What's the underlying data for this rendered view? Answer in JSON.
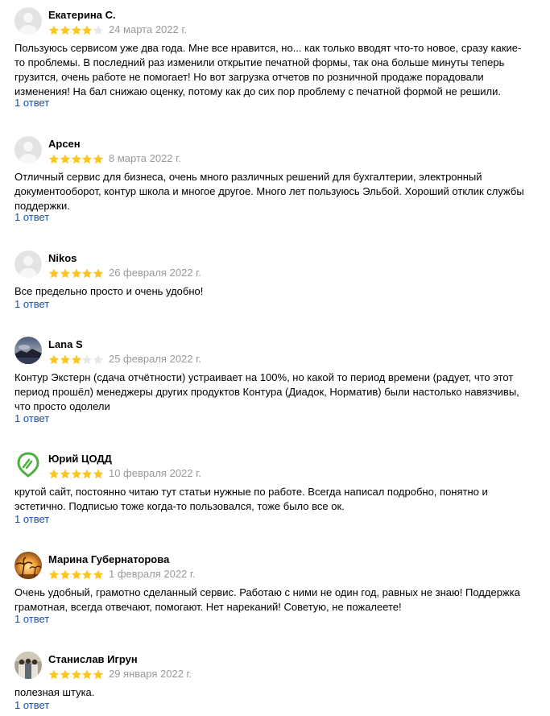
{
  "colors": {
    "star_filled": "#fcc521",
    "star_empty": "#e6e6e6",
    "date": "#999999",
    "link": "#1a4fa8"
  },
  "reviews": [
    {
      "author": "Екатерина С.",
      "avatar": "default-user-avatar",
      "rating": 4,
      "date": "24 марта 2022 г.",
      "text": "Пользуюсь сервисом уже два года. Мне все нравится, но... как только вводят что-то новое, сразу какие-то проблемы. В последний раз изменили открытие печатной формы, так она больше минуты теперь грузится, очень работе не помогает! Но вот загрузка отчетов по розничной продаже порадовали изменения! На бал снижаю оценку, потому как до сих пор проблему с печатной формой не решили.",
      "replies": "1 ответ"
    },
    {
      "author": "Арсен",
      "avatar": "default-user-avatar",
      "rating": 5,
      "date": "8 марта 2022 г.",
      "text": "Отличный сервис для бизнеса, очень много различных решений для бухгалтерии, электронный документооборот, контур школа и многое другое. Много лет пользуюсь Эльбой. Хороший отклик службы поддержки.",
      "replies": "1 ответ"
    },
    {
      "author": "Nikos",
      "avatar": "default-user-avatar",
      "rating": 5,
      "date": "26 февраля 2022 г.",
      "text": "Все предельно просто и очень удобно!",
      "replies": "1 ответ"
    },
    {
      "author": "Lana S",
      "avatar": "landscape-photo-avatar",
      "rating": 3,
      "date": "25 февраля 2022 г.",
      "text": "Контур Экстерн (сдача отчётности) устраивает на 100%, но какой то период времени (радует, что этот период прошёл) менеджеры других продуктов Контура (Диадок, Норматив) были настолько навязчивы, что просто одолели",
      "replies": "1 ответ"
    },
    {
      "author": "Юрий ЦОДД",
      "avatar": "green-map-pin-avatar",
      "rating": 5,
      "date": "10 февраля 2022 г.",
      "text": "крутой сайт, постоянно читаю тут статьи нужные по работе. Всегда написал подробно, понятно и эстетично. Подписью тоже когда-то пользовался, тоже было все ок.",
      "replies": "1 ответ"
    },
    {
      "author": "Марина Губернаторова",
      "avatar": "sunset-palm-avatar",
      "rating": 5,
      "date": "1 февраля 2022 г.",
      "text": "Очень удобный, грамотно сделанный сервис. Работаю с ними не один год, равных не знаю! Поддержка грамотная, всегда отвечают, помогают. Нет нареканий! Советую, не пожалеете!",
      "replies": "1 ответ"
    },
    {
      "author": "Станислав Игрун",
      "avatar": "group-photo-avatar",
      "rating": 5,
      "date": "29 января 2022 г.",
      "text": "полезная штука.",
      "replies": "1 ответ"
    }
  ]
}
